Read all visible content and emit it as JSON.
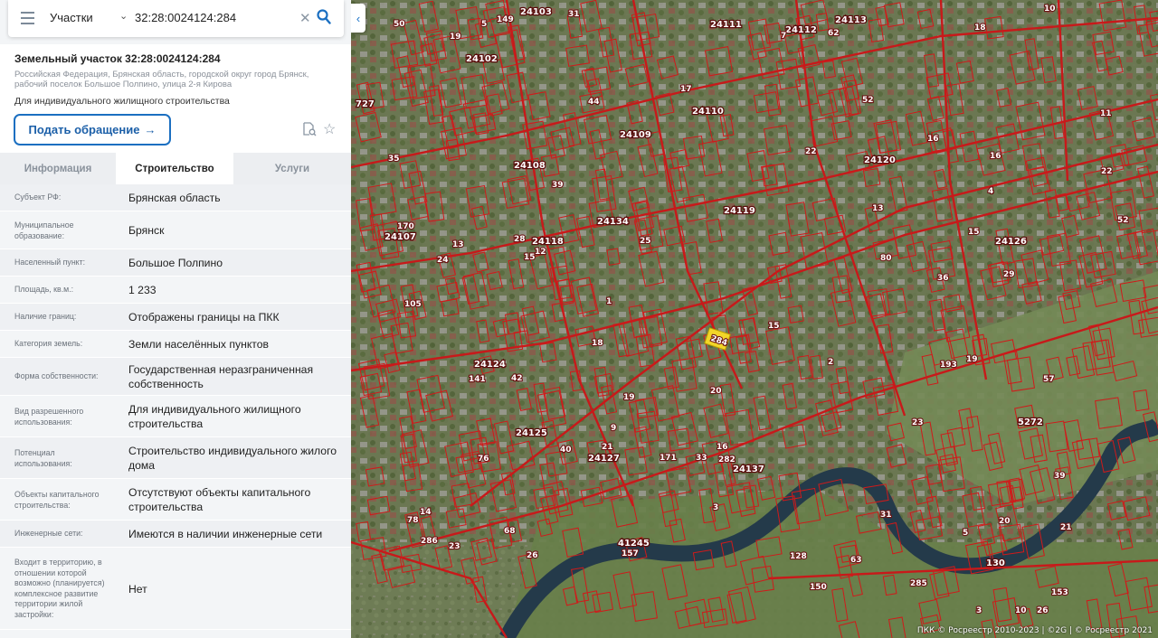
{
  "search": {
    "layer": "Участки",
    "value": "32:28:0024124:284"
  },
  "parcel": {
    "title": "Земельный участок 32:28:0024124:284",
    "address": "Российская Федерация, Брянская область, городской округ город Брянск, рабочий поселок Большое Полпино, улица 2-я Кирова",
    "purpose": "Для индивидуального жилищного строительства",
    "appeal_button": "Подать обращение",
    "appeal_arrow": "→"
  },
  "tabs": [
    {
      "label": "Информация",
      "active": false
    },
    {
      "label": "Строительство",
      "active": true
    },
    {
      "label": "Услуги",
      "active": false
    }
  ],
  "properties": [
    {
      "key": "Субъект РФ:",
      "value": "Брянская область"
    },
    {
      "key": "Муниципальное образование:",
      "value": "Брянск"
    },
    {
      "key": "Населенный пункт:",
      "value": "Большое Полпино"
    },
    {
      "key": "Площадь, кв.м.:",
      "value": "1 233"
    },
    {
      "key": "Наличие границ:",
      "value": "Отображены границы на ПКК"
    },
    {
      "key": "Категория земель:",
      "value": "Земли населённых пунктов"
    },
    {
      "key": "Форма собственности:",
      "value": "Государственная неразграниченная собственность"
    },
    {
      "key": "Вид разрешенного использования:",
      "value": "Для индивидуального жилищного строительства"
    },
    {
      "key": "Потенциал использования:",
      "value": "Строительство индивидуального жилого дома"
    },
    {
      "key": "Объекты капитального строительства:",
      "value": "Отсутствуют объекты капитального строительства"
    },
    {
      "key": "Инженерные сети:",
      "value": "Имеются в наличии инженерные сети"
    },
    {
      "key": "Входит в территорию, в отношении которой возможно (планируется) комплексное развитие территории жилой застройки:",
      "value": "Нет"
    }
  ],
  "map": {
    "selected_parcel": "284",
    "block_labels": [
      "24103",
      "24111",
      "24112",
      "24113",
      "24102",
      "24110",
      "24108",
      "24109",
      "24120",
      "24134",
      "24118",
      "24119",
      "24107",
      "24126",
      "24124",
      "24125",
      "24127",
      "24137",
      "5272",
      "41245",
      "130",
      "727"
    ],
    "parcel_labels": [
      "20",
      "15",
      "5",
      "19",
      "26",
      "44",
      "33",
      "18",
      "21",
      "36",
      "29",
      "7",
      "50",
      "3",
      "1",
      "31",
      "15",
      "52",
      "11",
      "25",
      "10",
      "12",
      "63",
      "40",
      "20",
      "80",
      "128",
      "14",
      "16",
      "78",
      "9",
      "171",
      "23",
      "39",
      "16",
      "170",
      "13",
      "149",
      "42",
      "157",
      "105",
      "153",
      "57",
      "285",
      "282",
      "286",
      "16",
      "39",
      "31",
      "52",
      "150",
      "15",
      "2",
      "18",
      "22",
      "13",
      "26",
      "19",
      "76",
      "68",
      "62",
      "17",
      "35",
      "193",
      "5",
      "24",
      "10",
      "22",
      "23",
      "19",
      "141",
      "28",
      "3",
      "4",
      "21"
    ],
    "credit": "ПКК © Росреестр 2010-2023 | ©2G | © Росреестр 2021"
  },
  "colors": {
    "accent": "#1b6fc1",
    "parcel_outline": "#d01a1a",
    "selected_parcel": "#f2d629"
  },
  "icons": {
    "menu": "menu-icon",
    "chevron": "chevron-down-icon",
    "clear": "close-icon",
    "search": "search-icon",
    "doc_search": "document-search-icon",
    "star": "star-icon",
    "collapse": "chevron-left-icon"
  }
}
